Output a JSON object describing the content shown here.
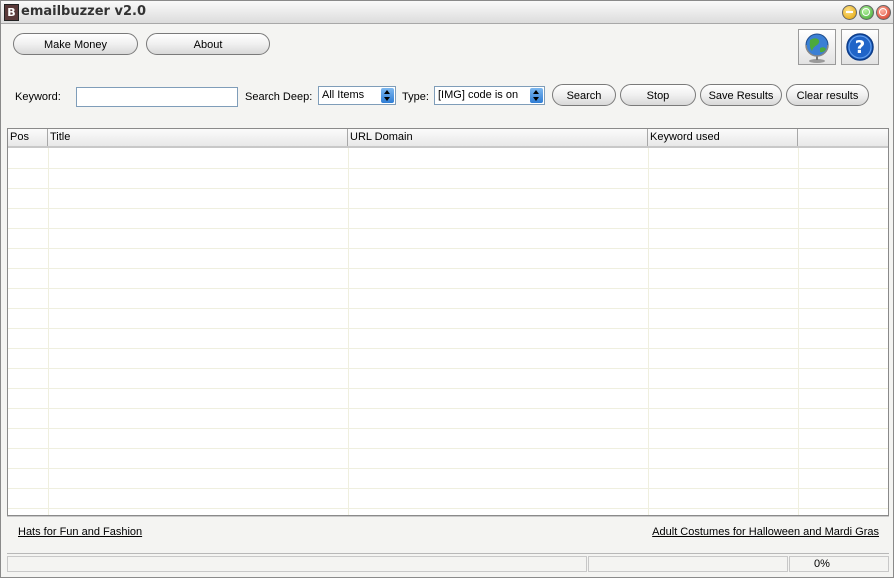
{
  "window": {
    "title": "emailbuzzer v2.0",
    "app_icon_glyph": "B"
  },
  "toolbar": {
    "make_money": "Make Money",
    "about": "About"
  },
  "icons": {
    "globe": "globe-icon",
    "help": "help-icon"
  },
  "search": {
    "keyword_label": "Keyword:",
    "keyword_value": "",
    "deep_label": "Search Deep:",
    "deep_value": "All Items",
    "type_label": "Type:",
    "type_value": "[IMG] code is on",
    "search_btn": "Search",
    "stop_btn": "Stop",
    "save_btn": "Save Results",
    "clear_btn": "Clear results"
  },
  "table": {
    "columns": [
      "Pos",
      "Title",
      "URL Domain",
      "Keyword used",
      ""
    ],
    "rows": []
  },
  "footer": {
    "left_link": "Hats for Fun and Fashion",
    "right_link": "Adult Costumes for Halloween and Mardi Gras"
  },
  "status": {
    "progress": "0%"
  },
  "colors": {
    "title_text": "#333333",
    "grid": "#efefdf",
    "input_border": "#7f9db9",
    "select_arrow": "#2f7dd5"
  }
}
